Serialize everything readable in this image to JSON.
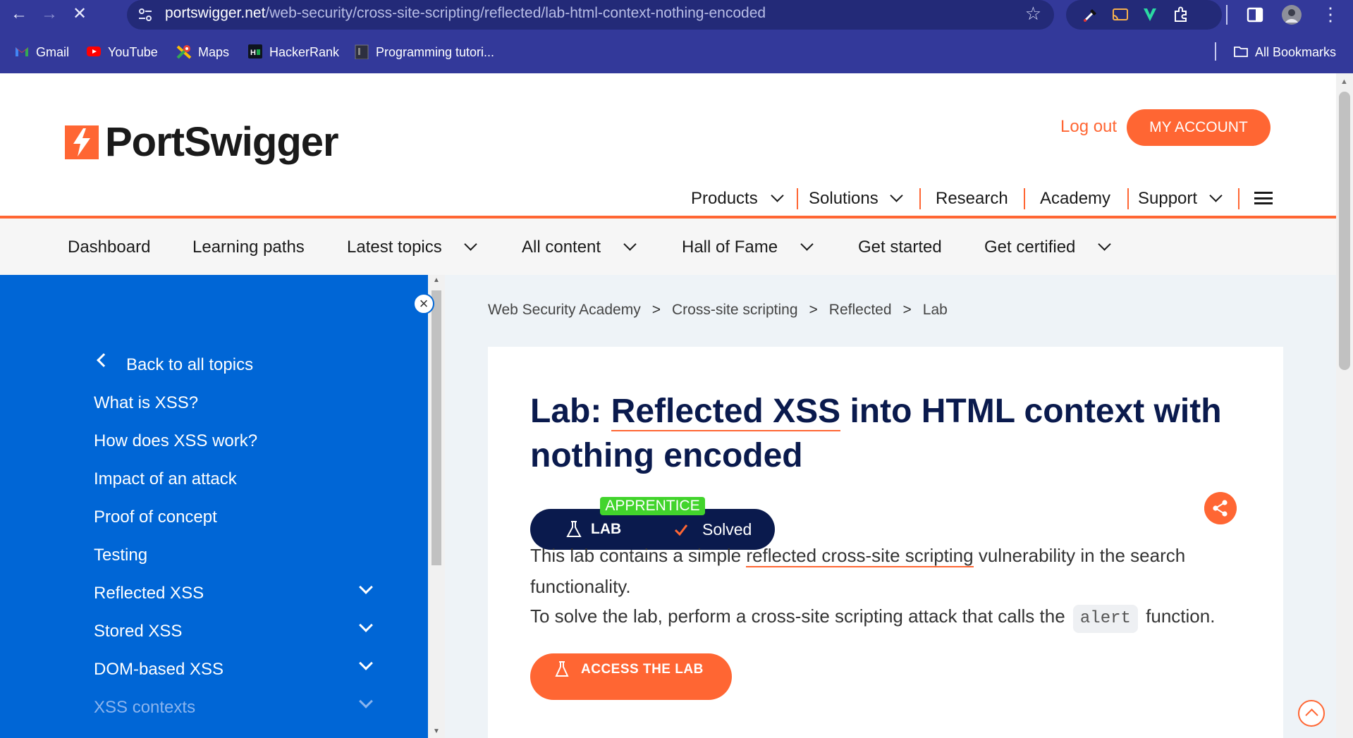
{
  "browser": {
    "url_host": "portswigger.net",
    "url_path": "/web-security/cross-site-scripting/reflected/lab-html-context-nothing-encoded",
    "bookmarks": [
      {
        "label": "Gmail",
        "icon": "gmail-icon"
      },
      {
        "label": "YouTube",
        "icon": "youtube-icon"
      },
      {
        "label": "Maps",
        "icon": "maps-icon"
      },
      {
        "label": "HackerRank",
        "icon": "hackerrank-icon"
      },
      {
        "label": "Programming tutori...",
        "icon": "bookmark-page-icon"
      }
    ],
    "all_bookmarks": "All Bookmarks"
  },
  "header": {
    "brand": "PortSwigger",
    "logout": "Log out",
    "my_account": "MY ACCOUNT",
    "nav": [
      "Products",
      "Solutions",
      "Research",
      "Academy",
      "Support"
    ]
  },
  "subnav": [
    "Dashboard",
    "Learning paths",
    "Latest topics",
    "All content",
    "Hall of Fame",
    "Get started",
    "Get certified"
  ],
  "sidebar": {
    "back": "Back to all topics",
    "items": [
      {
        "label": "What is XSS?"
      },
      {
        "label": "How does XSS work?"
      },
      {
        "label": "Impact of an attack"
      },
      {
        "label": "Proof of concept"
      },
      {
        "label": "Testing"
      },
      {
        "label": "Reflected XSS"
      },
      {
        "label": "Stored XSS"
      },
      {
        "label": "DOM-based XSS"
      },
      {
        "label": "XSS contexts"
      }
    ]
  },
  "breadcrumb": [
    "Web Security Academy",
    "Cross-site scripting",
    "Reflected",
    "Lab"
  ],
  "lab": {
    "title_prefix": "Lab: ",
    "title_link": "Reflected XSS",
    "title_rest": " into HTML context with nothing encoded",
    "level": "APPRENTICE",
    "type": "LAB",
    "status": "Solved",
    "p1_before": "This lab contains a simple ",
    "p1_link": "reflected cross-site scripting",
    "p1_after": " vulnerability in the search functionality.",
    "p2_before": "To solve the lab, perform a cross-site scripting attack that calls the",
    "p2_code": "alert",
    "p2_after": "function.",
    "access_button": "ACCESS THE LAB"
  },
  "colors": {
    "chrome": "#33399a",
    "brand_orange": "#ff6633",
    "sidebar_blue": "#0066d6",
    "navy": "#0a1a4d",
    "apprentice_green": "#42d42c"
  }
}
